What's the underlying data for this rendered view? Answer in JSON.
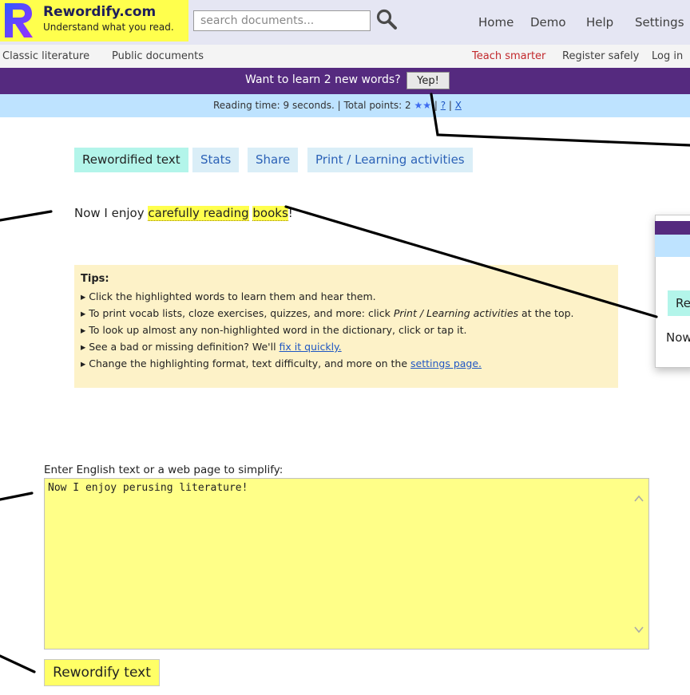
{
  "header": {
    "logo_title": "Rewordify.com",
    "logo_tagline": "Understand what you read.",
    "search_placeholder": "search documents...",
    "nav": [
      "Home",
      "Demo",
      "Help",
      "Settings"
    ]
  },
  "nav2": {
    "left": [
      "Classic literature",
      "Public documents"
    ],
    "teach": "Teach smarter",
    "register": "Register safely",
    "login": "Log in"
  },
  "learn_bar": {
    "prompt": "Want to learn 2 new words?",
    "button": "Yep!"
  },
  "status_bar": {
    "reading": "Reading time: 9 seconds. | Total points: 2",
    "stars": "★★",
    "help_link": "?",
    "close_link": "X"
  },
  "tabs": [
    "Rewordified text",
    "Stats",
    "Share",
    "Print / Learning activities"
  ],
  "sentence": {
    "prefix": "Now I enjoy ",
    "word1": "carefully reading",
    "word2": "books",
    "suffix": "!"
  },
  "tips": {
    "title": "Tips:",
    "items": [
      "Click the highlighted words to learn them and hear them.",
      "To print vocab lists, cloze exercises, quizzes, and more: click",
      "Print / Learning activities",
      "at the top.",
      "To look up almost any non-highlighted word in the dictionary, click or tap it.",
      "See a bad or missing definition? We'll",
      "fix it quickly.",
      "Change the highlighting format, text difficulty, and more on the",
      "settings page."
    ]
  },
  "input": {
    "label": "Enter English text or a web page to simplify:",
    "value": "Now I enjoy perusing literature!",
    "button": "Rewordify text"
  },
  "popup": {
    "tab_fragment": "Re",
    "text_fragment": "Now"
  },
  "colors": {
    "purple": "#552a7f",
    "highlight": "#ffff4d",
    "status_blue": "#bee3ff",
    "tab_active": "#b3f5ea",
    "input_yellow": "#ffff88"
  }
}
